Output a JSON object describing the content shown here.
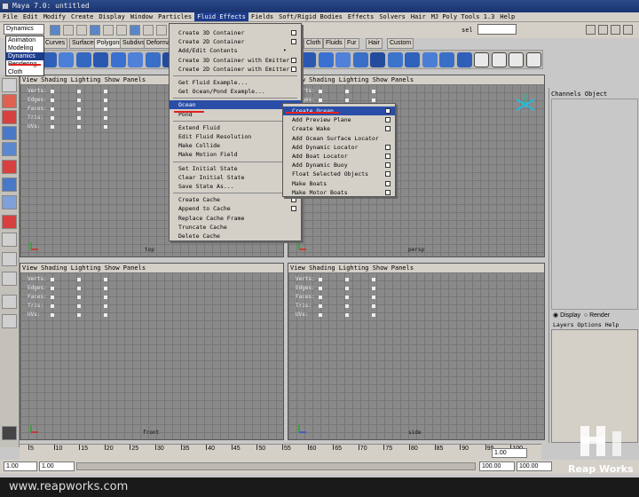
{
  "window": {
    "title": "Maya 7.0: untitled"
  },
  "menubar": {
    "items": [
      "File",
      "Edit",
      "Modify",
      "Create",
      "Display",
      "Window",
      "Particles",
      "Fluid Effects",
      "Fields",
      "Soft/Rigid Bodies",
      "Effects",
      "Solvers",
      "Hair",
      "MJ Poly Tools 1.3",
      "Help"
    ],
    "active": "Fluid Effects"
  },
  "mode_selector": {
    "value": "Dynamics",
    "options": [
      "Animation",
      "Modeling",
      "Dynamics",
      "Rendering",
      "Cloth"
    ]
  },
  "shelf_tabs": {
    "left": [
      "Curves",
      "Surfaces",
      "Polygons",
      "Subdivs",
      "Deformation"
    ],
    "right": [
      "Cloth",
      "Fluids",
      "Fur",
      "Hair",
      "Custom"
    ]
  },
  "status_field": {
    "label": "sel"
  },
  "fluid_menu": {
    "items": [
      {
        "label": "Create 3D Container",
        "option": true
      },
      {
        "label": "Create 2D Container",
        "option": true
      },
      {
        "label": "Add/Edit Contents",
        "submenu": true
      },
      {
        "label": "Create 3D Container with Emitter",
        "option": true
      },
      {
        "label": "Create 2D Container with Emitter",
        "option": true
      },
      {
        "label": "Get Fluid Example..."
      },
      {
        "label": "Get Ocean/Pond Example..."
      },
      {
        "label": "Ocean",
        "submenu": true,
        "highlighted": true
      },
      {
        "label": "Pond",
        "submenu": true
      },
      {
        "label": "Extend Fluid",
        "option": true
      },
      {
        "label": "Edit Fluid Resolution",
        "option": true
      },
      {
        "label": "Make Collide",
        "option": true
      },
      {
        "label": "Make Motion Field"
      },
      {
        "label": "Set Initial State",
        "option": true
      },
      {
        "label": "Clear Initial State"
      },
      {
        "label": "Save State As..."
      },
      {
        "label": "Create Cache",
        "option": true
      },
      {
        "label": "Append to Cache",
        "option": true
      },
      {
        "label": "Replace Cache Frame"
      },
      {
        "label": "Truncate Cache"
      },
      {
        "label": "Delete Cache"
      }
    ]
  },
  "ocean_menu": {
    "items": [
      {
        "label": "Create Ocean",
        "option": true,
        "highlighted": true
      },
      {
        "label": "Add Preview Plane",
        "option": true
      },
      {
        "label": "Create Wake",
        "option": true
      },
      {
        "label": "Add Ocean Surface Locator"
      },
      {
        "label": "Add Dynamic Locator",
        "option": true
      },
      {
        "label": "Add Boat Locator",
        "option": true
      },
      {
        "label": "Add Dynamic Buoy",
        "option": true
      },
      {
        "label": "Float Selected Objects",
        "option": true
      },
      {
        "label": "Make Boats",
        "option": true
      },
      {
        "label": "Make Motor Boats",
        "option": true
      }
    ]
  },
  "viewports": [
    {
      "menu": "View  Shading  Lighting  Show  Panels",
      "camera": "top"
    },
    {
      "menu": "View  Shading  Lighting  Show  Panels",
      "camera": "persp"
    },
    {
      "menu": "View  Shading  Lighting  Show  Panels",
      "camera": "front"
    },
    {
      "menu": "View  Shading  Lighting  Show  Panels",
      "camera": "side"
    }
  ],
  "hud_labels": [
    "Verts:",
    "Edges:",
    "Faces:",
    "Tris:",
    "UVs:"
  ],
  "channel_box": {
    "header": "Channels  Object",
    "display": "Display",
    "render": "Render",
    "layers_menu": "Layers  Options  Help"
  },
  "timeline": {
    "ticks": [
      "5",
      "10",
      "15",
      "20",
      "25",
      "30",
      "35",
      "40",
      "45",
      "50",
      "55",
      "60",
      "65",
      "70",
      "75",
      "80",
      "85",
      "90",
      "95",
      "100"
    ]
  },
  "range": {
    "start": "1.00",
    "current_start": "1.00",
    "current_end": "100.00",
    "end": "100.00",
    "frame": "1.00"
  },
  "watermark": {
    "url": "www.reapworks.com",
    "brand": "Reap Works"
  }
}
